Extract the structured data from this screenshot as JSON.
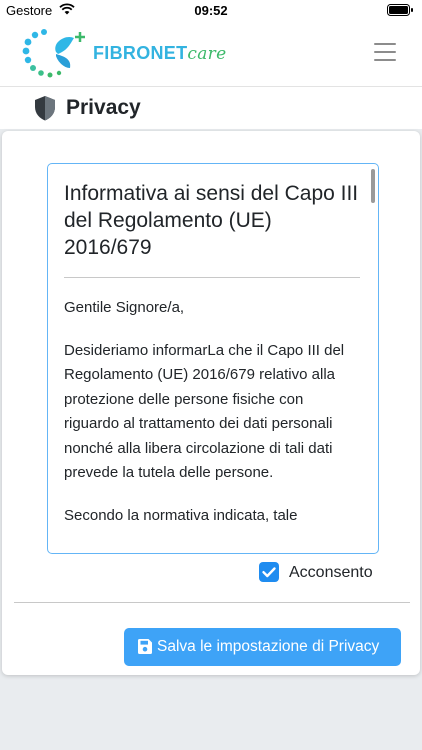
{
  "status_bar": {
    "carrier": "Gestore",
    "time": "09:52"
  },
  "navbar": {
    "brand_main": "FIBRONET",
    "brand_accent": "care"
  },
  "header": {
    "title": "Privacy"
  },
  "policy": {
    "title": "Informativa ai sensi del Capo III del Regolamento (UE) 2016/679",
    "paragraphs": [
      "Gentile Signore/a,",
      "Desideriamo informarLa che il Capo III del Regolamento (UE) 2016/679 relativo alla protezione delle persone fisiche con riguardo al trattamento dei dati personali nonché alla libera circolazione di tali dati prevede la tutela delle persone.",
      "Secondo la normativa indicata, tale"
    ]
  },
  "consent": {
    "label": "Acconsento",
    "checked": true
  },
  "actions": {
    "save_label": "Salva le impostazione di Privacy"
  },
  "colors": {
    "primary": "#3ea3f7",
    "brand_blue": "#33b3e0",
    "brand_green": "#3cb96a"
  }
}
